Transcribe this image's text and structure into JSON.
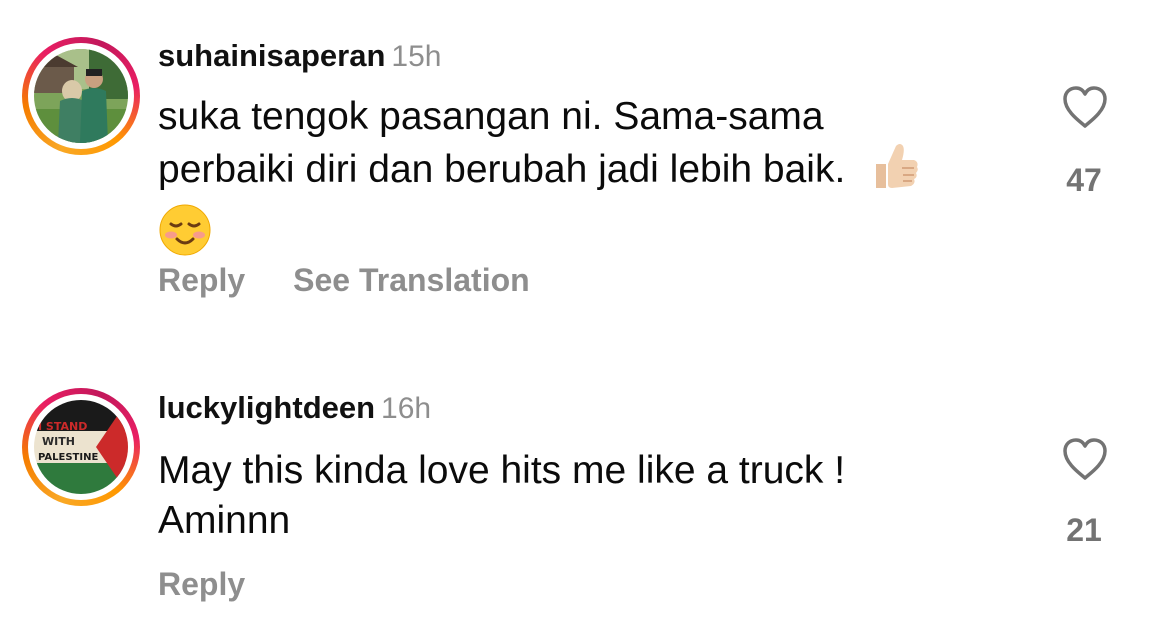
{
  "comments": [
    {
      "username": "suhainisaperan",
      "time": "15h",
      "line1": "suka tengok pasangan ni. Sama-sama",
      "line2": "perbaiki diri dan berubah jadi lebih baik.",
      "emoji_end_line2": "thumbs-up",
      "emoji_line3": "smiling-face",
      "reply_label": "Reply",
      "translate_label": "See Translation",
      "likes": "47"
    },
    {
      "username": "luckylightdeen",
      "time": "16h",
      "line1": "May this kinda love hits me like a truck !",
      "line2": "Aminnn",
      "avatar_text": [
        "I STAND",
        "WITH",
        "PALESTINE"
      ],
      "reply_label": "Reply",
      "likes": "21"
    }
  ],
  "colors": {
    "muted": "#8e8e8e",
    "text": "#0b0b0b",
    "ring_start": "#f9a825",
    "ring_end": "#e91e63"
  }
}
